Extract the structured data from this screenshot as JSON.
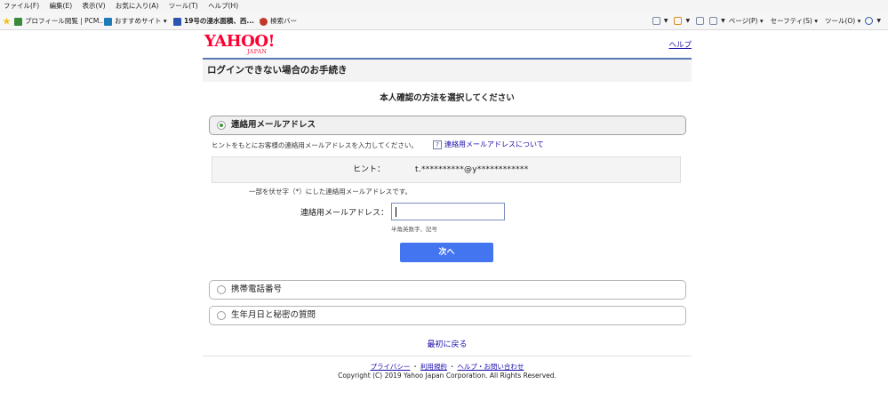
{
  "browser": {
    "menu": [
      "ファイル(F)",
      "編集(E)",
      "表示(V)",
      "お気に入り(A)",
      "ツール(T)",
      "ヘルプ(H)"
    ],
    "favorites": [
      {
        "label": "プロフィール閲覧 | PCM...",
        "icon": "profile-icon"
      },
      {
        "label": "おすすめサイト ▾",
        "icon": "bing-icon"
      },
      {
        "label": "19号の浸水面積、西...",
        "icon": "news-icon"
      },
      {
        "label": "検索バー",
        "icon": "searchbar-icon"
      }
    ],
    "toolbar": {
      "page_label": "ページ(P) ▾",
      "safety_label": "セーフティ(S) ▾",
      "tools_label": "ツール(O) ▾"
    }
  },
  "header": {
    "logo_main": "YAHOO!",
    "logo_sub": "JAPAN",
    "help_label": "ヘルプ"
  },
  "title": "ログインできない場合のお手続き",
  "subtitle": "本人確認の方法を選択してください",
  "options": [
    {
      "label": "連絡用メールアドレス",
      "selected": true
    },
    {
      "label": "携帯電話番号",
      "selected": false
    },
    {
      "label": "生年月日と秘密の質問",
      "selected": false
    }
  ],
  "email_section": {
    "instruction": "ヒントをもとにお客様の連絡用メールアドレスを入力してください。",
    "about_link": "連絡用メールアドレスについて",
    "hint_label": "ヒント：",
    "hint_value": "t.**********@y************",
    "masked_note": "一部を伏せ字（*）にした連絡用メールアドレスです。",
    "field_label": "連絡用メールアドレス：",
    "field_value": "",
    "field_hint": "半角英数字、記号",
    "next_button": "次へ"
  },
  "back_link": "最初に戻る",
  "footer": {
    "privacy": "プライバシー",
    "terms": "利用規約",
    "help_contact": "ヘルプ・お問い合わせ",
    "separator": "・",
    "copyright": "Copyright (C) 2019 Yahoo Japan Corporation. All Rights Reserved."
  },
  "colors": {
    "brand_red": "#ff0033",
    "link_blue": "#1a0dab",
    "button_blue": "#4475f0",
    "title_border": "#5a79b2"
  }
}
